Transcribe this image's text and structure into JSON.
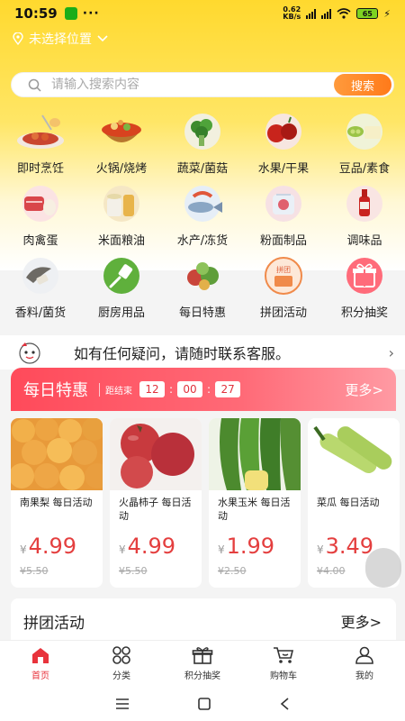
{
  "status": {
    "time": "10:59",
    "dots": "···",
    "net_speed_top": "0.62",
    "net_speed_bottom": "KB/s",
    "battery": "65"
  },
  "location": {
    "text": "未选择位置"
  },
  "search": {
    "placeholder": "请输入搜索内容",
    "button_label": "搜索"
  },
  "categories": [
    {
      "label": "即时烹饪",
      "icon": "cooked-dish-icon"
    },
    {
      "label": "火锅/烧烤",
      "icon": "hotpot-icon"
    },
    {
      "label": "蔬菜/菌菇",
      "icon": "broccoli-icon"
    },
    {
      "label": "水果/干果",
      "icon": "fruit-icon"
    },
    {
      "label": "豆品/素食",
      "icon": "tofu-icon"
    },
    {
      "label": "肉禽蛋",
      "icon": "meat-icon"
    },
    {
      "label": "米面粮油",
      "icon": "grain-icon"
    },
    {
      "label": "水产/冻货",
      "icon": "fish-icon"
    },
    {
      "label": "粉面制品",
      "icon": "noodle-icon"
    },
    {
      "label": "调味品",
      "icon": "sauce-icon"
    },
    {
      "label": "香料/菌货",
      "icon": "mushroom-icon"
    },
    {
      "label": "厨房用品",
      "icon": "spatula-icon"
    },
    {
      "label": "每日特惠",
      "icon": "vegetables-icon"
    },
    {
      "label": "拼团活动",
      "icon": "group-buy-icon"
    },
    {
      "label": "积分抽奖",
      "icon": "gift-icon"
    }
  ],
  "notice": {
    "text": "如有任何疑问，请随时联系客服。"
  },
  "daily": {
    "title": "每日特惠",
    "countdown_label": "距结束",
    "hours": "12",
    "minutes": "00",
    "seconds": "27",
    "more": "更多>",
    "products": [
      {
        "name": "南果梨 每日活动",
        "price": "4.99",
        "old_price": "¥5.50",
        "image": "pears-image"
      },
      {
        "name": "火晶柿子 每日活动",
        "price": "4.99",
        "old_price": "¥5.50",
        "image": "persimmons-image"
      },
      {
        "name": "水果玉米 每日活动",
        "price": "1.99",
        "old_price": "¥2.50",
        "image": "corn-image"
      },
      {
        "name": "菜瓜 每日活动",
        "price": "3.49",
        "old_price": "¥4.00",
        "image": "zucchini-image"
      }
    ],
    "currency": "¥"
  },
  "pintuan": {
    "title": "拼团活动",
    "more": "更多>"
  },
  "tabbar": [
    {
      "label": "首页",
      "icon": "home-icon"
    },
    {
      "label": "分类",
      "icon": "grid-icon"
    },
    {
      "label": "积分抽奖",
      "icon": "gift-icon"
    },
    {
      "label": "购物车",
      "icon": "cart-icon"
    },
    {
      "label": "我的",
      "icon": "user-icon"
    }
  ],
  "colors": {
    "accent": "#e8333c",
    "header_yellow": "#ffd92e",
    "price_red": "#e43f3f",
    "button_orange": "#ff8a2a"
  }
}
